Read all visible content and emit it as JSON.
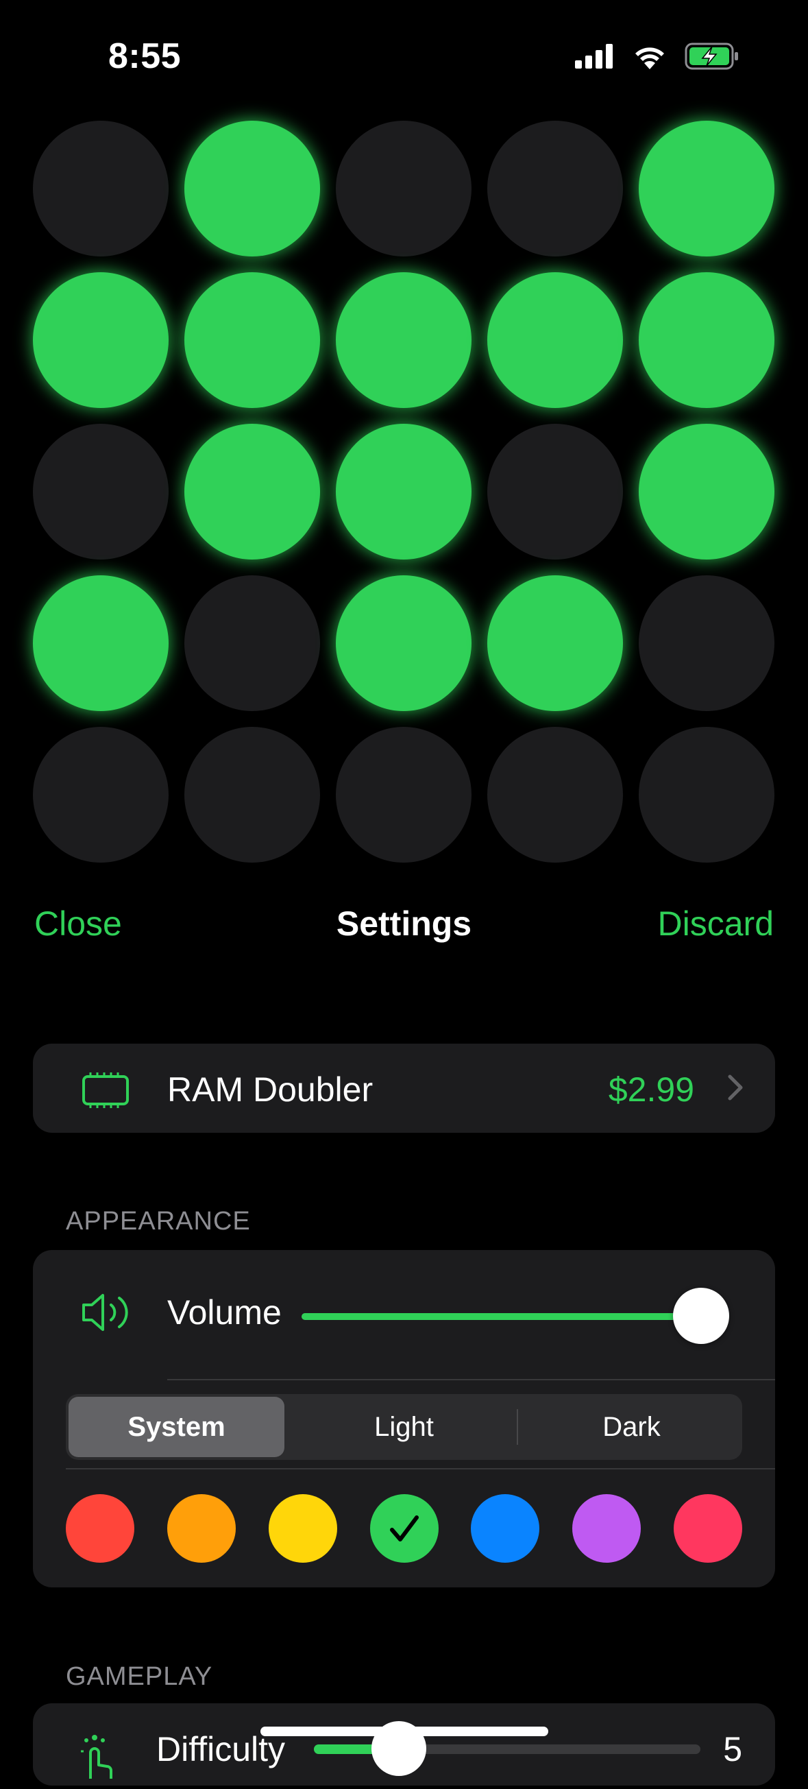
{
  "status_bar": {
    "time": "8:55"
  },
  "board": {
    "rows": [
      [
        false,
        true,
        false,
        false,
        true
      ],
      [
        true,
        true,
        true,
        true,
        true
      ],
      [
        false,
        true,
        true,
        false,
        true
      ],
      [
        true,
        false,
        true,
        true,
        false
      ],
      [
        false,
        false,
        false,
        false,
        false
      ]
    ],
    "on_color": "#30d158",
    "off_color": "#1c1c1e"
  },
  "nav": {
    "close_label": "Close",
    "title": "Settings",
    "discard_label": "Discard"
  },
  "purchase": {
    "label": "RAM Doubler",
    "price": "$2.99",
    "icon": "memory-chip-icon"
  },
  "appearance": {
    "header": "APPEARANCE",
    "volume_label": "Volume",
    "volume_level": 1.0,
    "theme_options": [
      "System",
      "Light",
      "Dark"
    ],
    "theme_selected": "System",
    "accent_colors": [
      "#ff453a",
      "#ff9f0a",
      "#ffd60a",
      "#30d158",
      "#0a84ff",
      "#bf5af2",
      "#ff375f"
    ],
    "accent_selected_index": 3
  },
  "gameplay": {
    "header": "GAMEPLAY",
    "difficulty_label": "Difficulty",
    "difficulty_value": "5",
    "difficulty_fraction": 0.22
  }
}
